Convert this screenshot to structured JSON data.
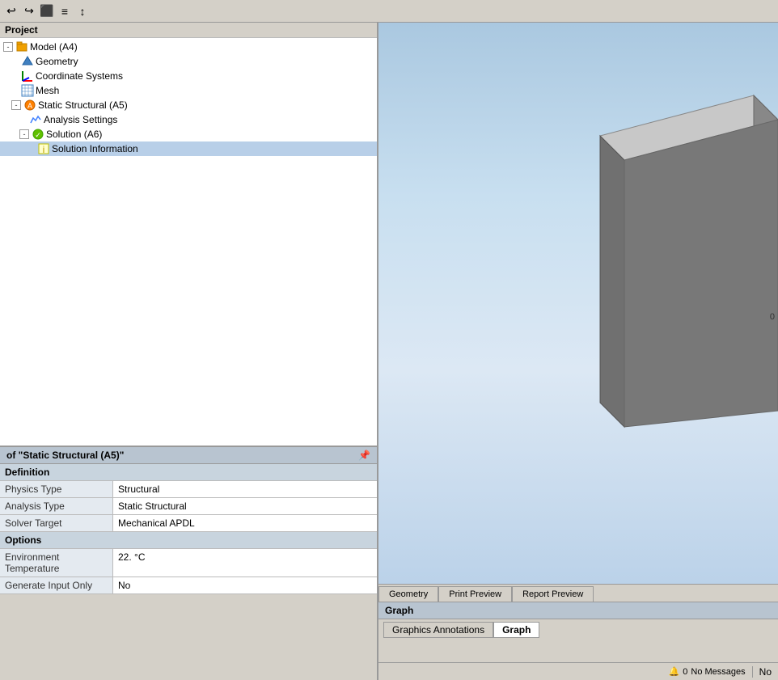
{
  "toolbar": {
    "icons": [
      "↩",
      "↪",
      "⬛",
      "≡",
      "↕"
    ]
  },
  "project_label": "Project",
  "tree": {
    "items": [
      {
        "id": "model",
        "label": "Model (A4)",
        "indent": 0,
        "has_expand": true,
        "expanded": true,
        "icon": "📦"
      },
      {
        "id": "geometry",
        "label": "Geometry",
        "indent": 1,
        "has_expand": false,
        "icon": "🔷"
      },
      {
        "id": "coordinate_systems",
        "label": "Coordinate Systems",
        "indent": 1,
        "has_expand": false,
        "icon": "📐"
      },
      {
        "id": "mesh",
        "label": "Mesh",
        "indent": 1,
        "has_expand": false,
        "icon": "🔲"
      },
      {
        "id": "static_structural",
        "label": "Static Structural (A5)",
        "indent": 1,
        "has_expand": true,
        "expanded": true,
        "icon": "⚡"
      },
      {
        "id": "analysis_settings",
        "label": "Analysis Settings",
        "indent": 2,
        "has_expand": false,
        "icon": "🔧"
      },
      {
        "id": "solution",
        "label": "Solution (A6)",
        "indent": 2,
        "has_expand": true,
        "expanded": true,
        "icon": "✅"
      },
      {
        "id": "solution_information",
        "label": "Solution Information",
        "indent": 3,
        "has_expand": false,
        "icon": "ℹ"
      }
    ]
  },
  "properties": {
    "title": "of \"Static Structural (A5)\"",
    "pin_label": "📌",
    "sections": [
      {
        "name": "Definition",
        "rows": [
          {
            "key": "Physics Type",
            "value": "Structural"
          },
          {
            "key": "Analysis Type",
            "value": "Static Structural"
          },
          {
            "key": "Solver Target",
            "value": "Mechanical APDL"
          }
        ]
      },
      {
        "name": "Options",
        "rows": [
          {
            "key": "Environment Temperature",
            "value": "22. °C"
          },
          {
            "key": "Generate Input Only",
            "value": "No"
          }
        ]
      }
    ]
  },
  "viewport_tabs": [
    {
      "label": "Geometry",
      "active": false
    },
    {
      "label": "Print Preview",
      "active": false
    },
    {
      "label": "Report Preview",
      "active": false
    }
  ],
  "graph_section": {
    "title": "Graph",
    "tabs": [
      {
        "label": "Graphics Annotations",
        "active": false
      },
      {
        "label": "Graph",
        "active": true
      }
    ]
  },
  "status_bar": {
    "messages_icon": "🔔",
    "messages_count": "0",
    "messages_label": "No Messages",
    "right_label": "No"
  },
  "coord_label": "0"
}
